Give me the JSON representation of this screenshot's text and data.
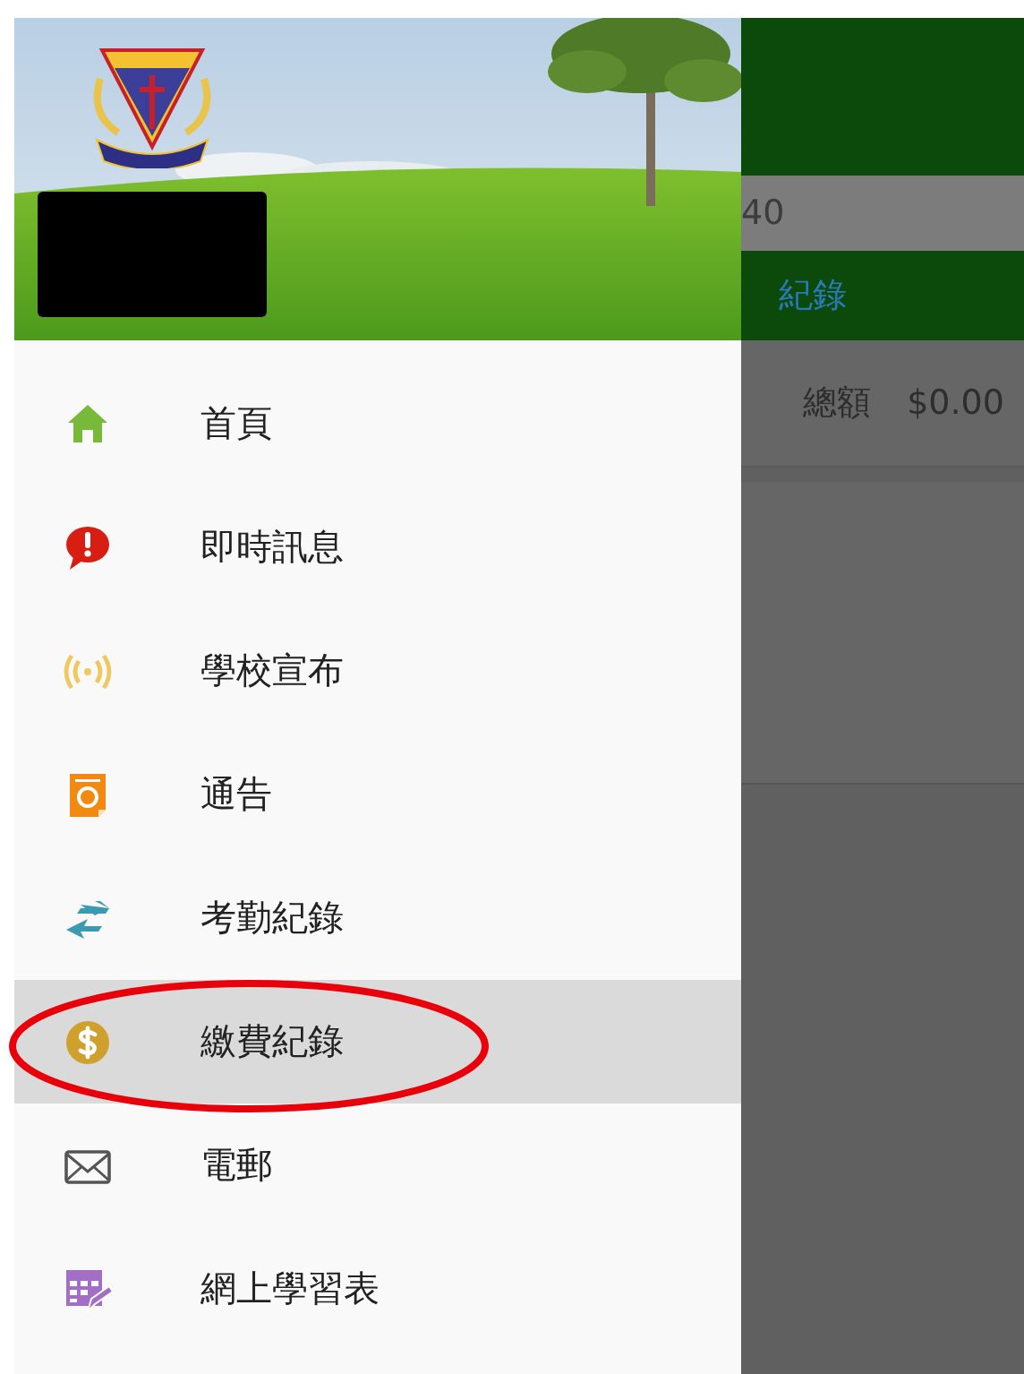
{
  "background_screen": {
    "field_value": "40",
    "section_title": "紀錄",
    "total_label": "總額",
    "total_value": "$0.00"
  },
  "drawer": {
    "items": [
      {
        "kind": "home",
        "label": "首頁",
        "selected": false
      },
      {
        "kind": "alert",
        "label": "即時訊息",
        "selected": false
      },
      {
        "kind": "broadcast",
        "label": "學校宣布",
        "selected": false
      },
      {
        "kind": "notice",
        "label": "通告",
        "selected": false
      },
      {
        "kind": "attendance",
        "label": "考勤紀錄",
        "selected": false
      },
      {
        "kind": "payment",
        "label": "繳費紀錄",
        "selected": true
      },
      {
        "kind": "email",
        "label": "電郵",
        "selected": false
      },
      {
        "kind": "schedule",
        "label": "網上學習表",
        "selected": false
      }
    ]
  }
}
